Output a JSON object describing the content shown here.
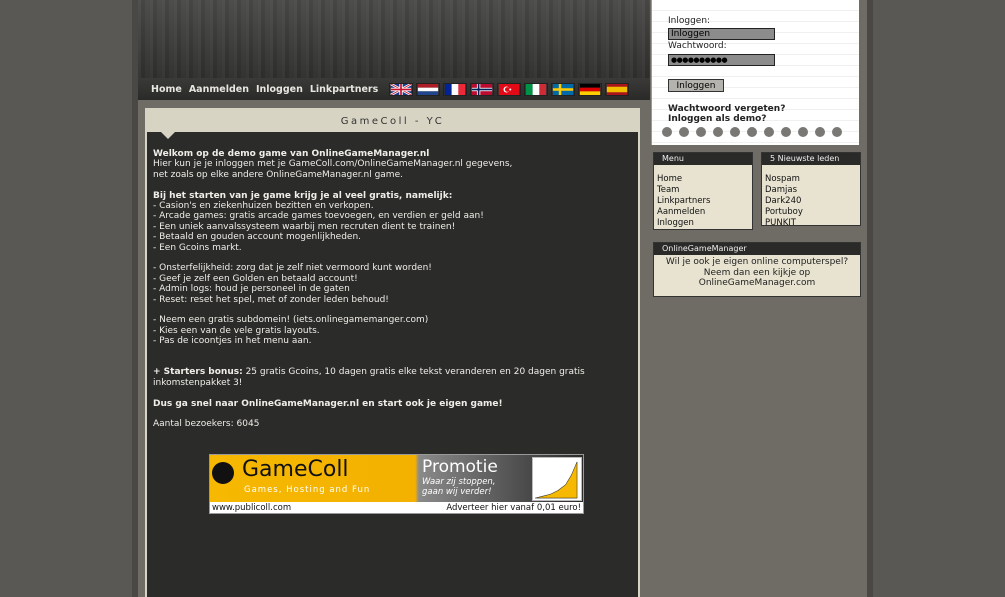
{
  "nav": {
    "items": [
      {
        "label": "Home"
      },
      {
        "label": "Aanmelden"
      },
      {
        "label": "Inloggen"
      },
      {
        "label": "Linkpartners"
      }
    ],
    "flags": [
      "uk-flag-icon",
      "netherlands-flag-icon",
      "france-flag-icon",
      "norway-flag-icon",
      "turkey-flag-icon",
      "italy-flag-icon",
      "sweden-flag-icon",
      "germany-flag-icon",
      "spain-flag-icon"
    ]
  },
  "login": {
    "username_label": "Inloggen:",
    "username_value": "Inloggen",
    "password_label": "Wachtwoord:",
    "password_value": "●●●●●●●●●●",
    "submit_label": "Inloggen",
    "forgot_label": "Wachtwoord vergeten?",
    "demo_label": "Inloggen als demo?"
  },
  "main": {
    "title": "GameColl - YC",
    "welcome_heading": "Welkom op de demo game van OnlineGameManager.nl",
    "welcome_line1": "Hier kun je je inloggen met je GameColl.com/OnlineGameManager.nl gegevens,",
    "welcome_line2": "net zoals op elke andere OnlineGameManager.nl game.",
    "start_heading": "Bij het starten van je game krijg je al veel gratis, namelijk:",
    "features1": [
      "- Casion's en ziekenhuizen bezitten en verkopen.",
      "- Arcade games: gratis arcade games toevoegen, en verdien er geld aan!",
      "- Een uniek aanvalssysteem waarbij men recruten dient te trainen!",
      "- Betaald en gouden account mogenlijkheden.",
      "- Een Gcoins markt."
    ],
    "features2": [
      "- Onsterfelijkheid: zorg dat je zelf niet vermoord kunt worden!",
      "- Geef je zelf een Golden en betaald account!",
      "- Admin logs: houd je personeel in de gaten",
      "- Reset: reset het spel, met of zonder leden behoud!"
    ],
    "features3": [
      "- Neem een gratis subdomein! (iets.onlinegamemanger.com)",
      "- Kies een van de vele gratis layouts.",
      "- Pas de icoontjes in het menu aan."
    ],
    "bonus_bold": "+ Starters bonus:",
    "bonus_text": " 25 gratis Gcoins, 10 dagen gratis elke tekst veranderen en 20 dagen gratis",
    "bonus_text2": "inkomstenpakket 3!",
    "cta": "Dus ga snel naar OnlineGameManager.nl en start ook je eigen game!",
    "visitors": "Aantal bezoekers: 6045"
  },
  "banner": {
    "logo": "GameColl",
    "sub": "Games, Hosting and Fun",
    "promo": "Promotie",
    "slogan1": "Waar zij stoppen,",
    "slogan2": "gaan wij verder!",
    "url": "www.publicoll.com",
    "ad": "Adverteer hier vanaf 0,01 euro!"
  },
  "menu": {
    "title": "Menu",
    "items": [
      "Home",
      "Team",
      "Linkpartners",
      "Aanmelden",
      "Inloggen"
    ]
  },
  "new_members": {
    "title": "5 Nieuwste leden",
    "items": [
      "Nospam",
      "Damjas",
      "Dark240",
      "Portuboy",
      "PUNKIT"
    ]
  },
  "ogm": {
    "title": "OnlineGameManager",
    "line1": "Wil je ook je eigen online computerspel?",
    "line2": "Neem dan een kijkje op",
    "line3": "OnlineGameManager.com"
  },
  "colors": {
    "content_bg": "#2b2b2a",
    "panel_beige": "#e7e3d0",
    "banner_yellow": "#f6b800"
  }
}
